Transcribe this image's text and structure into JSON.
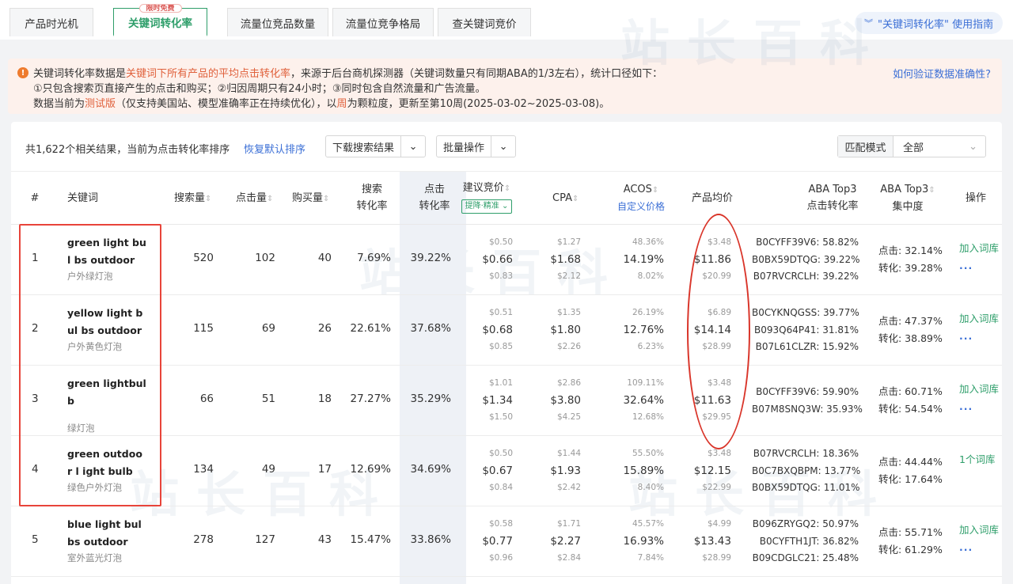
{
  "tabs": [
    {
      "label": "产品时光机",
      "active": false
    },
    {
      "label": "关键词转化率",
      "active": true,
      "badge": "限时免费"
    },
    {
      "label": "流量位竞品数量",
      "active": false
    },
    {
      "label": "流量位竞争格局",
      "active": false
    },
    {
      "label": "查关键词竞价",
      "active": false
    }
  ],
  "guide": {
    "label": "\"关键词转化率\" 使用指南",
    "icon": "double-chevron-down-icon"
  },
  "notice": {
    "line1_pre": "关键词转化率数据是",
    "line1_red": "关键词下所有产品的平均点击转化率",
    "line1_post": "，来源于后台商机探测器（关键词数量只有同期ABA的1/3左右），统计口径如下：",
    "line2": "①只包含搜索页直接产生的点击和购买；②归因周期只有24小时；③同时包含自然流量和广告流量。",
    "line3_pre": "数据当前为",
    "line3_red": "测试版",
    "line3_mid": "（仅支持美国站、模型准确率正在持续优化），以",
    "line3_red2": "周",
    "line3_post": "为颗粒度，更新至第10周(2025-03-02~2025-03-08)。",
    "verify_link": "如何验证数据准确性?"
  },
  "toolbar": {
    "summary": "共1,622个相关结果，当前为点击转化率排序",
    "reset": "恢复默认排序",
    "download": "下载搜索结果",
    "batch": "批量操作",
    "match_label": "匹配模式",
    "match_value": "全部"
  },
  "columns": {
    "index": "#",
    "keyword": "关键词",
    "search_volume": "搜索量",
    "clicks": "点击量",
    "purchases": "购买量",
    "search_cvr_1": "搜索",
    "search_cvr_2": "转化率",
    "click_cvr_1": "点击",
    "click_cvr_2": "转化率",
    "bid": "建议竞价",
    "bid_chip": "提降·精准",
    "cpa": "CPA",
    "acos": "ACOS",
    "acos_sub": "自定义价格",
    "avg_price": "产品均价",
    "aba_top3_1": "ABA Top3",
    "aba_top3_2": "点击转化率",
    "aba_conc_1": "ABA Top3",
    "aba_conc_2": "集中度",
    "action": "操作"
  },
  "rows": [
    {
      "index": "1",
      "kw_en": "green light bul bs outdoor",
      "kw_cn": "户外绿灯泡",
      "search": "520",
      "clicks": "102",
      "purchases": "40",
      "search_cvr": "7.69%",
      "click_cvr": "39.22%",
      "bid": [
        "$0.50",
        "$0.66",
        "$0.83"
      ],
      "cpa": [
        "$1.27",
        "$1.68",
        "$2.12"
      ],
      "acos": [
        "48.36%",
        "14.19%",
        "8.02%"
      ],
      "price": [
        "$3.48",
        "$11.86",
        "$20.99"
      ],
      "aba": [
        "B0CYFF39V6: 58.82%",
        "B0BX59DTQG: 39.22%",
        "B07RVCRCLH: 39.22%"
      ],
      "click_conc": "点击: 32.14%",
      "conv_conc": "转化: 39.28%",
      "action": "加入词库",
      "more": "..."
    },
    {
      "index": "2",
      "kw_en": "yellow light bul bs outdoor",
      "kw_cn": "户外黄色灯泡",
      "search": "115",
      "clicks": "69",
      "purchases": "26",
      "search_cvr": "22.61%",
      "click_cvr": "37.68%",
      "bid": [
        "$0.51",
        "$0.68",
        "$0.85"
      ],
      "cpa": [
        "$1.35",
        "$1.80",
        "$2.26"
      ],
      "acos": [
        "26.19%",
        "12.76%",
        "6.23%"
      ],
      "price": [
        "$6.89",
        "$14.14",
        "$28.99"
      ],
      "aba": [
        "B0CYKNQGSS: 39.77%",
        "B093Q64P41: 31.81%",
        "B07L61CLZR: 15.92%"
      ],
      "click_conc": "点击: 47.37%",
      "conv_conc": "转化: 38.89%",
      "action": "加入词库",
      "more": "..."
    },
    {
      "index": "3",
      "kw_en": "green lightbulb",
      "kw_cn": "绿灯泡",
      "search": "66",
      "clicks": "51",
      "purchases": "18",
      "search_cvr": "27.27%",
      "click_cvr": "35.29%",
      "bid": [
        "$1.01",
        "$1.34",
        "$1.50"
      ],
      "cpa": [
        "$2.86",
        "$3.80",
        "$4.25"
      ],
      "acos": [
        "109.11%",
        "32.64%",
        "12.68%"
      ],
      "price": [
        "$3.48",
        "$11.63",
        "$29.95"
      ],
      "aba": [
        "B0CYFF39V6: 59.90%",
        "B07M8SNQ3W: 35.93%",
        ""
      ],
      "click_conc": "点击: 60.71%",
      "conv_conc": "转化: 54.54%",
      "action": "加入词库",
      "more": "..."
    },
    {
      "index": "4",
      "kw_en": "green outdoor l ight bulb",
      "kw_cn": "绿色户外灯泡",
      "search": "134",
      "clicks": "49",
      "purchases": "17",
      "search_cvr": "12.69%",
      "click_cvr": "34.69%",
      "bid": [
        "$0.50",
        "$0.67",
        "$0.84"
      ],
      "cpa": [
        "$1.44",
        "$1.93",
        "$2.42"
      ],
      "acos": [
        "55.50%",
        "15.89%",
        "8.40%"
      ],
      "price": [
        "$3.48",
        "$12.15",
        "$22.99"
      ],
      "aba": [
        "B07RVCRCLH: 18.36%",
        "B0C7BXQBPM: 13.77%",
        "B0BX59DTQG: 11.01%"
      ],
      "click_conc": "点击: 44.44%",
      "conv_conc": "转化: 17.64%",
      "action": "1个词库",
      "more": ""
    },
    {
      "index": "5",
      "kw_en": "blue light bulbs outdoor",
      "kw_cn": "室外蓝光灯泡",
      "search": "278",
      "clicks": "127",
      "purchases": "43",
      "search_cvr": "15.47%",
      "click_cvr": "33.86%",
      "bid": [
        "$0.58",
        "$0.77",
        "$0.96"
      ],
      "cpa": [
        "$1.71",
        "$2.27",
        "$2.84"
      ],
      "acos": [
        "45.57%",
        "16.93%",
        "7.84%"
      ],
      "price": [
        "$4.99",
        "$13.43",
        "$28.99"
      ],
      "aba": [
        "B096ZRYGQ2: 50.97%",
        "B0CYFTH1JT: 36.82%",
        "B09CDGLC21: 25.48%"
      ],
      "click_conc": "点击: 55.71%",
      "conv_conc": "转化: 61.29%",
      "action": "加入词库",
      "more": "..."
    }
  ],
  "watermark": "站长百科",
  "colors": {
    "accent": "#2e9e6a",
    "link": "#3b6fd6",
    "alert": "#e0613c",
    "highlight": "#e8443a"
  }
}
